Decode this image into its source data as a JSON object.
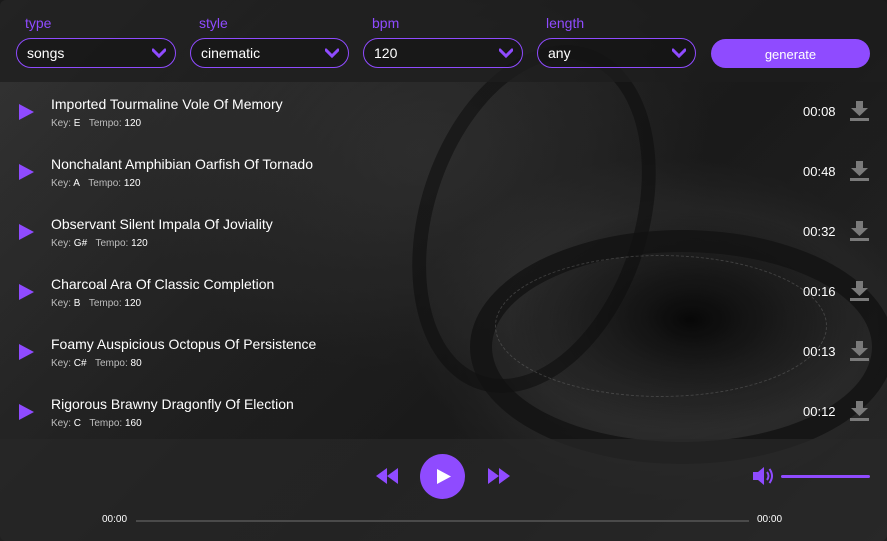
{
  "filters": [
    {
      "label": "type",
      "value": "songs"
    },
    {
      "label": "style",
      "value": "cinematic"
    },
    {
      "label": "bpm",
      "value": "120"
    },
    {
      "label": "length",
      "value": "any"
    }
  ],
  "generate_label": "generate",
  "meta_labels": {
    "key": "Key:",
    "tempo": "Tempo:"
  },
  "tracks": [
    {
      "title": "Imported Tourmaline Vole Of Memory",
      "key": "E",
      "tempo": "120",
      "duration": "00:08"
    },
    {
      "title": "Nonchalant Amphibian Oarfish Of Tornado",
      "key": "A",
      "tempo": "120",
      "duration": "00:48"
    },
    {
      "title": "Observant Silent Impala Of Joviality",
      "key": "G#",
      "tempo": "120",
      "duration": "00:32"
    },
    {
      "title": "Charcoal Ara Of Classic Completion",
      "key": "B",
      "tempo": "120",
      "duration": "00:16"
    },
    {
      "title": "Foamy Auspicious Octopus Of Persistence",
      "key": "C#",
      "tempo": "80",
      "duration": "00:13"
    },
    {
      "title": "Rigorous Brawny Dragonfly Of Election",
      "key": "C",
      "tempo": "160",
      "duration": "00:12"
    }
  ],
  "player": {
    "current_time": "00:00",
    "total_time": "00:00",
    "volume": 1.0
  },
  "icons": {
    "row_play": "play-icon",
    "download": "download-icon",
    "rewind": "rewind-icon",
    "play": "play-icon",
    "forward": "fast-forward-icon",
    "volume": "volume-icon",
    "dropdown": "chevron-down-icon"
  },
  "colors": {
    "accent": "#8f4bff",
    "download_icon": "#7a7a7a",
    "text": "#ffffff",
    "meta_text": "#bdbdbd"
  }
}
